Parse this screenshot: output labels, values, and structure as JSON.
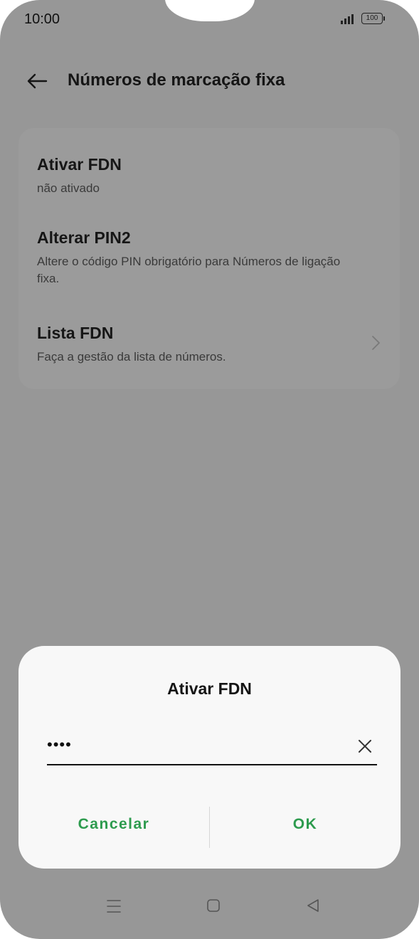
{
  "status_bar": {
    "time": "10:00",
    "battery": "100",
    "icons": [
      "signal-icon",
      "battery-icon"
    ]
  },
  "header": {
    "back_icon": "arrow-left-icon",
    "title": "Números de marcação fixa"
  },
  "settings": {
    "items": [
      {
        "title": "Ativar FDN",
        "subtitle": "não ativado"
      },
      {
        "title": "Alterar PIN2",
        "subtitle": "Altere o código PIN obrigatório para Números de ligação fixa."
      },
      {
        "title": "Lista FDN",
        "subtitle": "Faça a gestão da lista de números."
      }
    ]
  },
  "dialog": {
    "title": "Ativar FDN",
    "pin_value": "••••",
    "cancel_label": "Cancelar",
    "ok_label": "OK",
    "accent_color": "#2d9b4e"
  },
  "nav_bar": {
    "icons": [
      "menu-icon",
      "home-icon",
      "back-icon"
    ]
  }
}
